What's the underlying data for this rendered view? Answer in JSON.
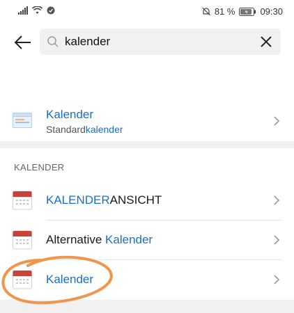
{
  "status": {
    "battery": "81 %",
    "time": "09:30"
  },
  "search": {
    "value": "kalender"
  },
  "top_result": {
    "title": "Kalender",
    "subtitle_prefix": "Standard",
    "subtitle_match": "kalender"
  },
  "section": {
    "header": "KALENDER",
    "items": [
      {
        "match": "KALENDER",
        "rest": "ANSICHT"
      },
      {
        "prefix": "Alternative ",
        "match": "Kalender"
      },
      {
        "match": "Kalender"
      }
    ]
  },
  "colors": {
    "highlight": "#1a6fc4",
    "annotation": "#f0954a"
  },
  "icons": {
    "back": "arrow-left-icon",
    "search": "search-icon",
    "clear": "close-icon",
    "settings_item": "window-icon",
    "calendar": "calendar-icon",
    "chevron": "chevron-right-icon"
  }
}
